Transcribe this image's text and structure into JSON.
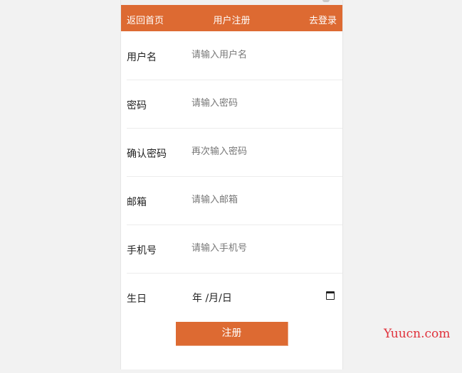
{
  "header": {
    "back": "返回首页",
    "title": "用户注册",
    "login": "去登录"
  },
  "form": {
    "fields": [
      {
        "label": "用户名",
        "placeholder": "请输入用户名"
      },
      {
        "label": "密码",
        "placeholder": "请输入密码"
      },
      {
        "label": "确认密码",
        "placeholder": "再次输入密码"
      },
      {
        "label": "邮箱",
        "placeholder": "请输入邮箱"
      },
      {
        "label": "手机号",
        "placeholder": "请输入手机号"
      }
    ],
    "birthday": {
      "label": "生日",
      "value": "年 /月/日"
    },
    "submit": "注册"
  },
  "watermark": "Yuucn.com",
  "colors": {
    "accent": "#dd6a32",
    "watermark": "#e0313b"
  }
}
